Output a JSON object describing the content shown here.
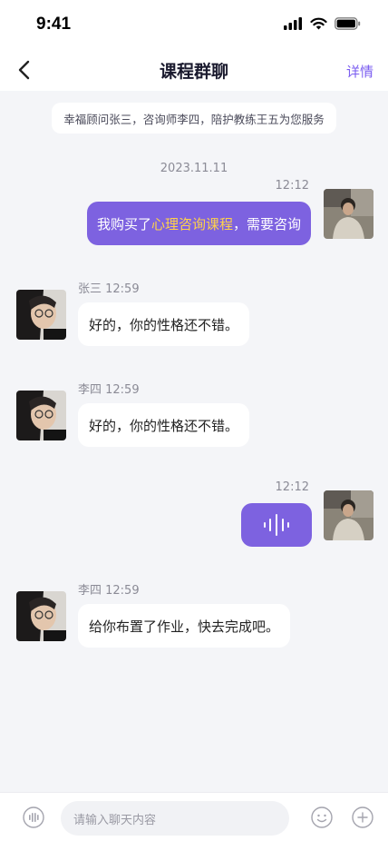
{
  "status": {
    "time": "9:41"
  },
  "nav": {
    "title": "课程群聊",
    "detail": "详情"
  },
  "notice": "幸福顾问张三，咨询师李四，陪护教练王五为您服务",
  "date": "2023.11.11",
  "messages": [
    {
      "meta": "12:12",
      "pre": "我购买了",
      "highlight": "心理咨询课程",
      "post": "，需要咨询"
    },
    {
      "meta": "张三 12:59",
      "text": "好的，你的性格还不错。"
    },
    {
      "meta": "李四 12:59",
      "text": "好的，你的性格还不错。"
    },
    {
      "meta": "12:12"
    },
    {
      "meta": "李四 12:59",
      "text": "给你布置了作业，快去完成吧。"
    }
  ],
  "input": {
    "placeholder": "请输入聊天内容"
  },
  "colors": {
    "accent": "#7d62e0",
    "highlight": "#ffd24a",
    "background": "#f4f5f8"
  },
  "icons": [
    "back-arrow-icon",
    "signal-icon",
    "wifi-icon",
    "battery-icon",
    "voice-wave-icon",
    "voice-input-icon",
    "emoji-icon",
    "add-icon"
  ]
}
